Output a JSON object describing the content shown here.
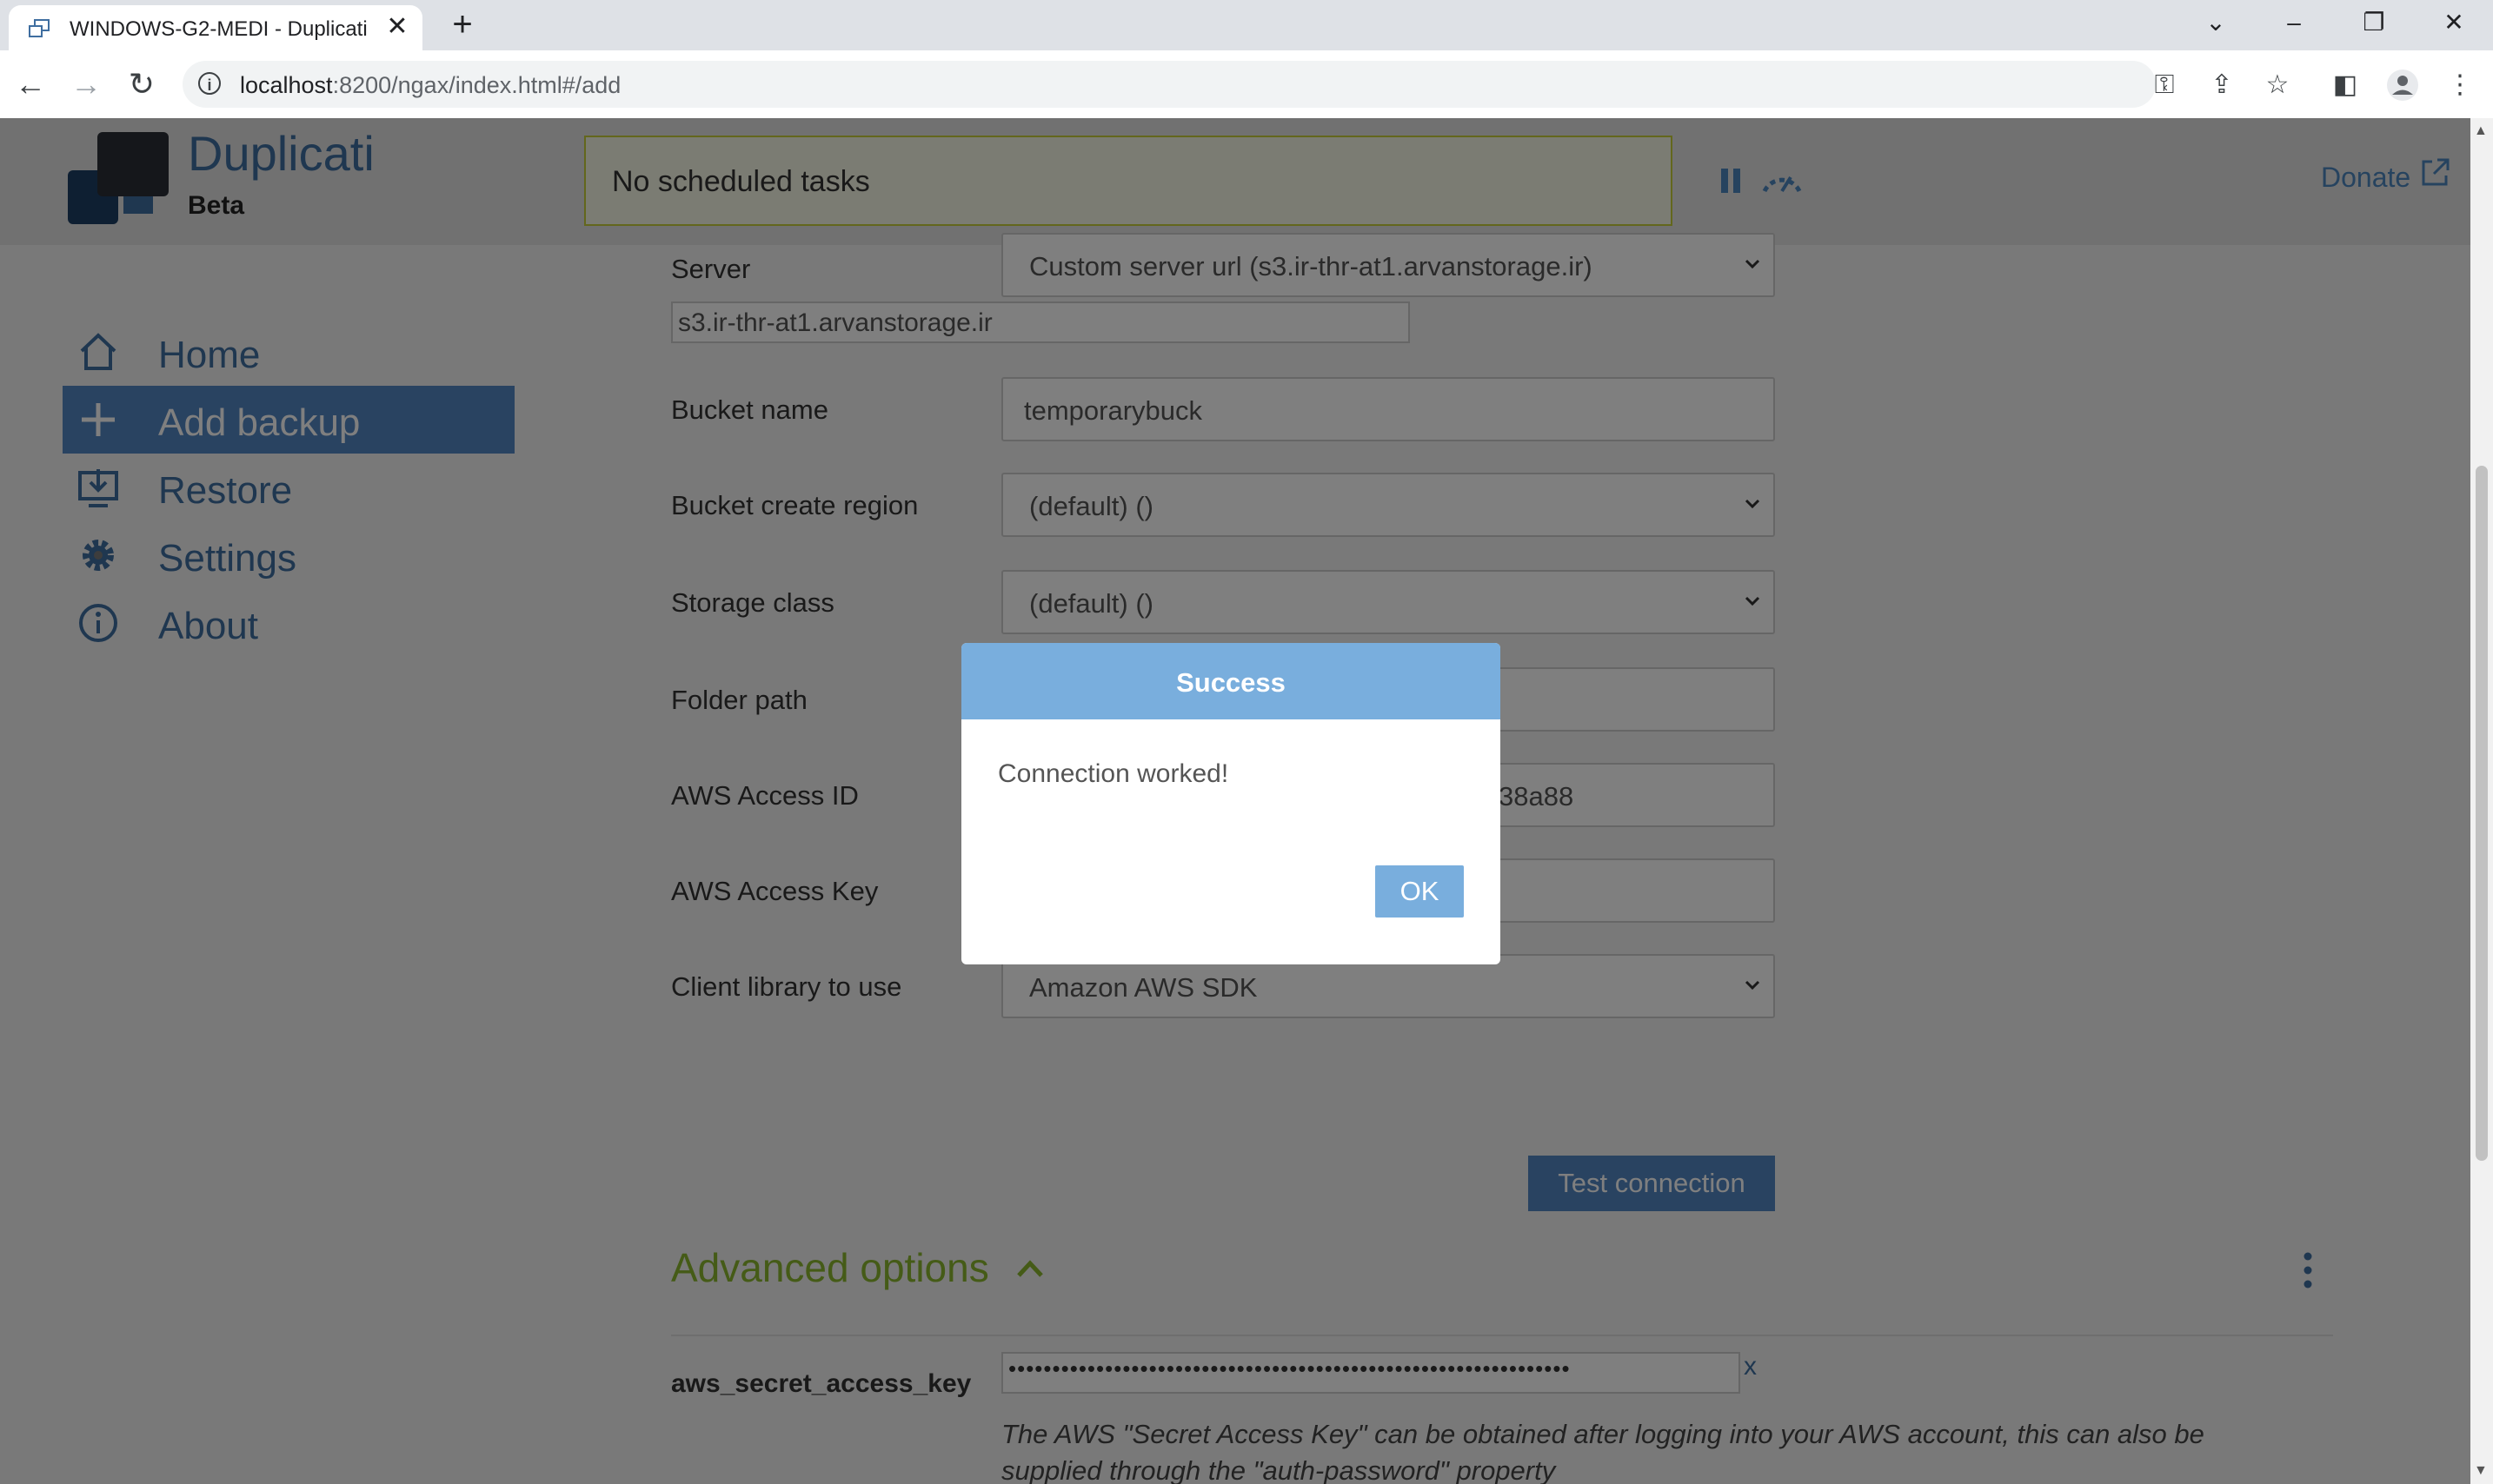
{
  "browser": {
    "tab_title": "WINDOWS-G2-MEDI - Duplicati",
    "url_host": "localhost",
    "url_rest": ":8200/ngax/index.html#/add"
  },
  "header": {
    "app_name": "Duplicati",
    "app_sub": "Beta",
    "status_text": "No scheduled tasks",
    "donate_label": "Donate"
  },
  "nav": {
    "items": [
      {
        "label": "Home",
        "icon": "home-icon"
      },
      {
        "label": "Add backup",
        "icon": "plus-icon",
        "active": true
      },
      {
        "label": "Restore",
        "icon": "restore-icon"
      },
      {
        "label": "Settings",
        "icon": "gear-icon"
      },
      {
        "label": "About",
        "icon": "info-icon"
      }
    ]
  },
  "form": {
    "server_label": "Server",
    "server_value": "Custom server url (s3.ir-thr-at1.arvanstorage.ir)",
    "server_url_value": "s3.ir-thr-at1.arvanstorage.ir",
    "bucket_label": "Bucket name",
    "bucket_value": "temporarybuck",
    "region_label": "Bucket create region",
    "region_value": "(default) ()",
    "storage_label": "Storage class",
    "storage_value": "(default) ()",
    "folder_label": "Folder path",
    "folder_value": "",
    "access_id_label": "AWS Access ID",
    "access_id_value": "38a88",
    "access_key_label": "AWS Access Key",
    "access_key_value": "",
    "client_label": "Client library to use",
    "client_value": "Amazon AWS SDK",
    "test_button": "Test connection"
  },
  "advanced": {
    "title": "Advanced options",
    "option_key": "aws_secret_access_key",
    "option_value": "••••••••••••••••••••••••••••••••••••••••••••••••••••••••••••••••",
    "clear_label": "x",
    "help_text": "The AWS \"Secret Access Key\" can be obtained after logging into your AWS account, this can also be supplied through the \"auth-password\" property"
  },
  "modal": {
    "title": "Success",
    "message": "Connection worked!",
    "ok_label": "OK"
  },
  "colors": {
    "accent": "#5386c3",
    "modal_accent": "#79aedd",
    "advanced_green": "#8ab62e",
    "status_border": "#c7ce3a"
  }
}
